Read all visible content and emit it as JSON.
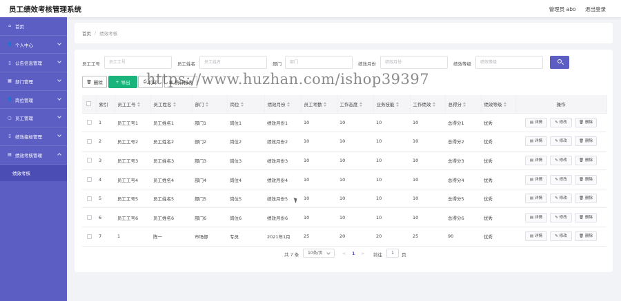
{
  "app_title": "员工绩效考核管理系统",
  "header": {
    "user_label": "管理员 abo",
    "logout_label": "退出登录"
  },
  "sidebar": {
    "items": [
      {
        "label": "首页",
        "icon": "home-icon",
        "has_children": false
      },
      {
        "label": "个人中心",
        "icon": "user-icon",
        "has_children": true
      },
      {
        "label": "公告信息管理",
        "icon": "notice-icon",
        "has_children": true
      },
      {
        "label": "部门管理",
        "icon": "department-icon",
        "has_children": true
      },
      {
        "label": "岗位管理",
        "icon": "position-icon",
        "has_children": true
      },
      {
        "label": "员工管理",
        "icon": "staff-icon",
        "has_children": true
      },
      {
        "label": "绩效指标管理",
        "icon": "indicator-icon",
        "has_children": true
      },
      {
        "label": "绩效考核管理",
        "icon": "assessment-icon",
        "has_children": true,
        "open": true
      }
    ],
    "sub_item": "绩效考核"
  },
  "breadcrumb": {
    "home": "首页",
    "separator": "/",
    "current": "绩效考核"
  },
  "filters": [
    {
      "label": "员工工号",
      "placeholder": "员工工号"
    },
    {
      "label": "员工姓名",
      "placeholder": "员工姓名"
    },
    {
      "label": "部门",
      "placeholder": "部门"
    },
    {
      "label": "绩效月份",
      "placeholder": "绩效月份"
    },
    {
      "label": "绩效等级",
      "placeholder": "绩效等级"
    }
  ],
  "toolbar": {
    "delete_label": "删除",
    "export_label": "导出",
    "print_label": "打印",
    "statistics_label": "统计报表"
  },
  "table": {
    "columns": [
      "索引",
      "员工工号",
      "员工姓名",
      "部门",
      "岗位",
      "绩效月份",
      "员工考勤",
      "工作态度",
      "业务技能",
      "工作绩效",
      "总得分",
      "绩效等级",
      "操作"
    ],
    "rows": [
      [
        "1",
        "员工工号1",
        "员工姓名1",
        "部门1",
        "岗位1",
        "绩效月份1",
        "10",
        "10",
        "10",
        "10",
        "总得分1",
        "优秀"
      ],
      [
        "2",
        "员工工号2",
        "员工姓名2",
        "部门2",
        "岗位2",
        "绩效月份2",
        "10",
        "10",
        "10",
        "10",
        "总得分2",
        "优秀"
      ],
      [
        "3",
        "员工工号3",
        "员工姓名3",
        "部门3",
        "岗位3",
        "绩效月份3",
        "10",
        "10",
        "10",
        "10",
        "总得分3",
        "优秀"
      ],
      [
        "4",
        "员工工号4",
        "员工姓名4",
        "部门4",
        "岗位4",
        "绩效月份4",
        "10",
        "10",
        "10",
        "10",
        "总得分4",
        "优秀"
      ],
      [
        "5",
        "员工工号5",
        "员工姓名5",
        "部门5",
        "岗位5",
        "绩效月份5",
        "10",
        "10",
        "10",
        "10",
        "总得分5",
        "优秀"
      ],
      [
        "6",
        "员工工号6",
        "员工姓名6",
        "部门6",
        "岗位6",
        "绩效月份6",
        "10",
        "10",
        "10",
        "10",
        "总得分6",
        "优秀"
      ],
      [
        "7",
        "1",
        "陈一",
        "市场部",
        "专员",
        "2021年1月",
        "25",
        "20",
        "20",
        "25",
        "90",
        "优秀"
      ]
    ],
    "row_actions": {
      "detail": "详情",
      "edit": "修改",
      "delete": "删除"
    }
  },
  "pagination": {
    "total_text": "共 7 条",
    "page_size": "10条/页",
    "prev": "<",
    "current_page": "1",
    "next": ">",
    "goto_label": "前往",
    "goto_value": "1",
    "page_unit": "页"
  },
  "watermark": "https://www.huzhan.com/ishop39397",
  "colors": {
    "sidebar": "#5c5ec4",
    "accent": "#5c5ec4",
    "export_button": "#18b47b"
  }
}
